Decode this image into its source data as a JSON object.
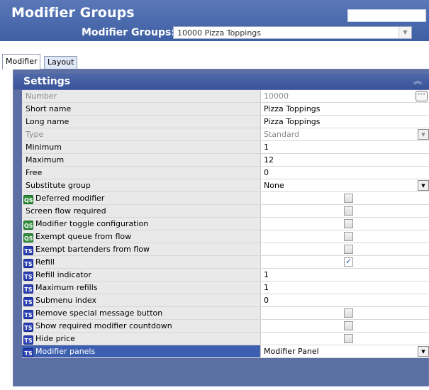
{
  "header": {
    "title": "Modifier Groups",
    "selector_label": "Modifier Groups:",
    "selector_value": "10000 Pizza Toppings"
  },
  "tabs": [
    {
      "label": "Modifier",
      "active": true
    },
    {
      "label": "Layout",
      "active": false
    }
  ],
  "settings": {
    "title": "Settings",
    "rows": [
      {
        "label": "Number",
        "value": "10000",
        "control": "ellipsis",
        "disabled": true
      },
      {
        "label": "Short name",
        "value": "Pizza Toppings",
        "control": "text"
      },
      {
        "label": "Long name",
        "value": "Pizza Toppings",
        "control": "text"
      },
      {
        "label": "Type",
        "value": "Standard",
        "control": "dropdown",
        "disabled": true
      },
      {
        "label": "Minimum",
        "value": "1",
        "control": "text"
      },
      {
        "label": "Maximum",
        "value": "12",
        "control": "text"
      },
      {
        "label": "Free",
        "value": "0",
        "control": "text"
      },
      {
        "label": "Substitute group",
        "value": "None",
        "control": "dropdown"
      },
      {
        "label": "Deferred modifier",
        "badge": "QS",
        "control": "checkbox",
        "checked": false
      },
      {
        "label": "Screen flow required",
        "control": "checkbox",
        "checked": false
      },
      {
        "label": "Modifier toggle configuration",
        "badge": "QS",
        "control": "checkbox",
        "checked": false
      },
      {
        "label": "Exempt queue from flow",
        "badge": "QS",
        "control": "checkbox",
        "checked": false
      },
      {
        "label": "Exempt bartenders from flow",
        "badge": "TS",
        "control": "checkbox",
        "checked": false
      },
      {
        "label": "Refill",
        "badge": "TS",
        "control": "checkbox",
        "checked": true
      },
      {
        "label": "Refill indicator",
        "badge": "TS",
        "value": "1",
        "control": "text"
      },
      {
        "label": "Maximum refills",
        "badge": "TS",
        "value": "1",
        "control": "text"
      },
      {
        "label": "Submenu index",
        "badge": "TS",
        "value": "0",
        "control": "text"
      },
      {
        "label": "Remove special message button",
        "badge": "TS",
        "control": "checkbox",
        "checked": false
      },
      {
        "label": "Show required modifier countdown",
        "badge": "TS",
        "control": "checkbox",
        "checked": false
      },
      {
        "label": "Hide price",
        "badge": "TS",
        "control": "checkbox",
        "checked": false
      },
      {
        "label": "Modifier panels",
        "badge": "TS",
        "value": "Modifier Panel",
        "control": "dropdown",
        "selected": true
      }
    ]
  },
  "colors": {
    "header_bg": "#4a68ac",
    "qs_badge": "#2f8d3a",
    "ts_badge": "#2a3fb4",
    "selected_row": "#3d5fb0"
  }
}
